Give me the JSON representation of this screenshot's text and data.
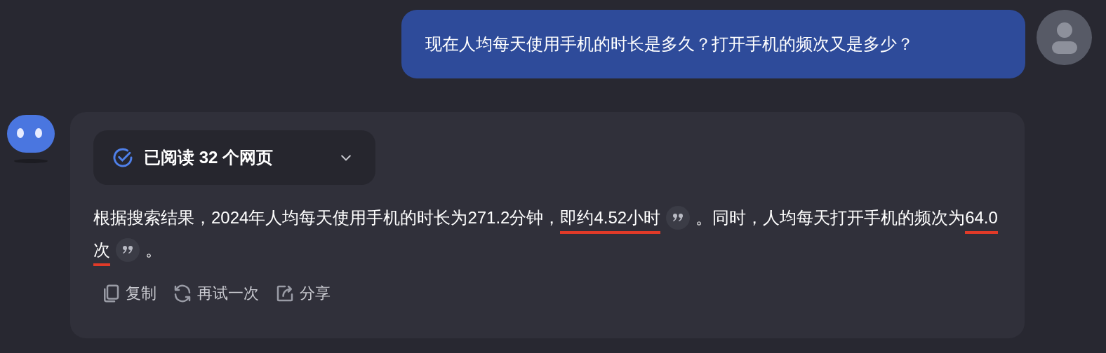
{
  "user_message": {
    "text": "现在人均每天使用手机的时长是多久？打开手机的频次又是多少？"
  },
  "answer": {
    "sources": {
      "label": "已阅读 32 个网页",
      "done": true,
      "expanded": false
    },
    "segments": [
      {
        "kind": "text",
        "text": "根据搜索结果，2024年人均每天使用手机的时长为271.2分钟，"
      },
      {
        "kind": "underlined",
        "text": "即约4.52小时"
      },
      {
        "kind": "citation"
      },
      {
        "kind": "text",
        "text": "。同时，人均每天打开手机的频次为"
      },
      {
        "kind": "underlined",
        "text": "64.0次"
      },
      {
        "kind": "citation"
      },
      {
        "kind": "text",
        "text": "。"
      }
    ],
    "actions": [
      {
        "kind": "copy",
        "label": "复制"
      },
      {
        "kind": "retry",
        "label": "再试一次"
      },
      {
        "kind": "share",
        "label": "分享"
      }
    ]
  }
}
